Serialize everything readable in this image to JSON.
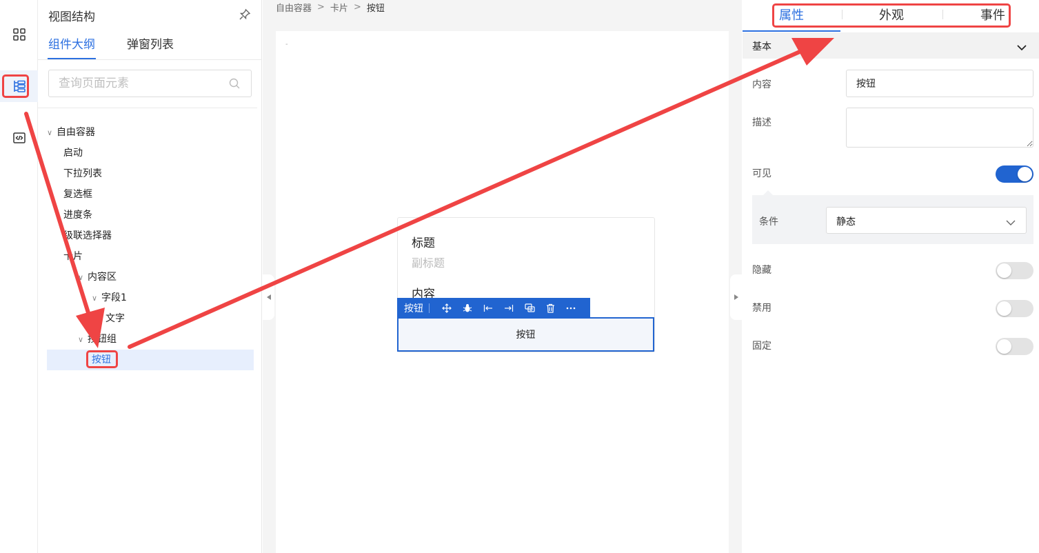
{
  "outline": {
    "title": "视图结构",
    "tabs": [
      "组件大纲",
      "弹窗列表"
    ],
    "search_placeholder": "查询页面元素",
    "tree": [
      "自由容器",
      "启动",
      "下拉列表",
      "复选框",
      "进度条",
      "级联选择器",
      "卡片",
      "内容区",
      "字段1",
      "文字",
      "按钮组",
      "按钮"
    ]
  },
  "canvas": {
    "breadcrumb": [
      "自由容器",
      "卡片",
      "按钮"
    ],
    "breadcrumb_sep": ">",
    "page_dash": "-",
    "card": {
      "title": "标题",
      "subtitle": "副标题",
      "content": "内容"
    },
    "toolbar_label": "按钮",
    "selected_button_label": "按钮"
  },
  "props": {
    "tabs": [
      "属性",
      "外观",
      "事件"
    ],
    "section": "基本",
    "content_label": "内容",
    "content_value": "按钮",
    "desc_label": "描述",
    "visible_label": "可见",
    "visible_on": true,
    "condition_label": "条件",
    "condition_value": "静态",
    "hidden_label": "隐藏",
    "disabled_label": "禁用",
    "fixed_label": "固定"
  },
  "colors": {
    "accent": "#2b6fe0",
    "selection_blue": "#2164d0",
    "annotation_red": "#ef4444"
  }
}
